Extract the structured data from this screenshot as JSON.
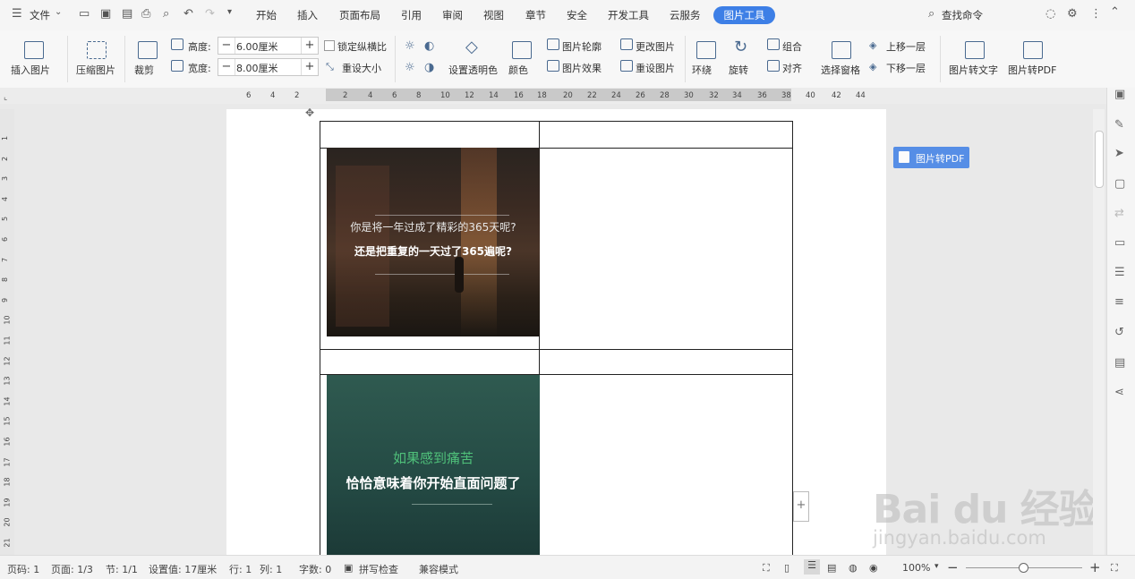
{
  "menubar": {
    "file_label": "文件",
    "tabs": [
      "开始",
      "插入",
      "页面布局",
      "引用",
      "审阅",
      "视图",
      "章节",
      "安全",
      "开发工具",
      "云服务"
    ],
    "active_tab": "图片工具",
    "search_label": "查找命令"
  },
  "ribbon": {
    "insert_picture": "插入图片",
    "compress_picture": "压缩图片",
    "crop": "裁剪",
    "height_label": "高度:",
    "height_value": "6.00厘米",
    "width_label": "宽度:",
    "width_value": "8.00厘米",
    "lock_ratio": "锁定纵横比",
    "reset_size": "重设大小",
    "set_transparent": "设置透明色",
    "color": "颜色",
    "picture_outline": "图片轮廓",
    "picture_effect": "图片效果",
    "change_picture": "更改图片",
    "reset_picture": "重设图片",
    "wrap": "环绕",
    "rotate": "旋转",
    "group": "组合",
    "align": "对齐",
    "selection_pane": "选择窗格",
    "bring_forward": "上移一层",
    "send_backward": "下移一层",
    "picture_to_text": "图片转文字",
    "picture_to_pdf": "图片转PDF"
  },
  "ruler": {
    "h_ticks": [
      "6",
      "4",
      "2",
      "2",
      "4",
      "6",
      "8",
      "10",
      "12",
      "14",
      "16",
      "18",
      "20",
      "22",
      "24",
      "26",
      "28",
      "30",
      "32",
      "34",
      "36",
      "38",
      "40",
      "42",
      "44"
    ],
    "v_ticks": [
      "1",
      "2",
      "3",
      "4",
      "5",
      "6",
      "7",
      "8",
      "9",
      "10",
      "11",
      "12",
      "13",
      "14",
      "15",
      "16",
      "17",
      "18",
      "19",
      "20",
      "21"
    ]
  },
  "document": {
    "image1_line1": "你是将一年过成了精彩的365天呢?",
    "image1_line2": "还是把重复的一天过了365遍呢?",
    "image2_line1": "如果感到痛苦",
    "image2_line2": "恰恰意味着你开始直面问题了"
  },
  "float_button": "图片转PDF",
  "watermark": {
    "brand": "Bai du 经验",
    "url": "jingyan.baidu.com"
  },
  "status": {
    "page_no": "页码: 1",
    "page_of": "页面: 1/3",
    "section": "节: 1/1",
    "setting": "设置值: 17厘米",
    "row": "行: 1",
    "col": "列: 1",
    "words": "字数: 0",
    "spell": "拼写检查",
    "compat": "兼容模式",
    "zoom": "100%"
  },
  "colors": {
    "accent": "#3d7fe6",
    "green_text": "#4fc07a"
  }
}
